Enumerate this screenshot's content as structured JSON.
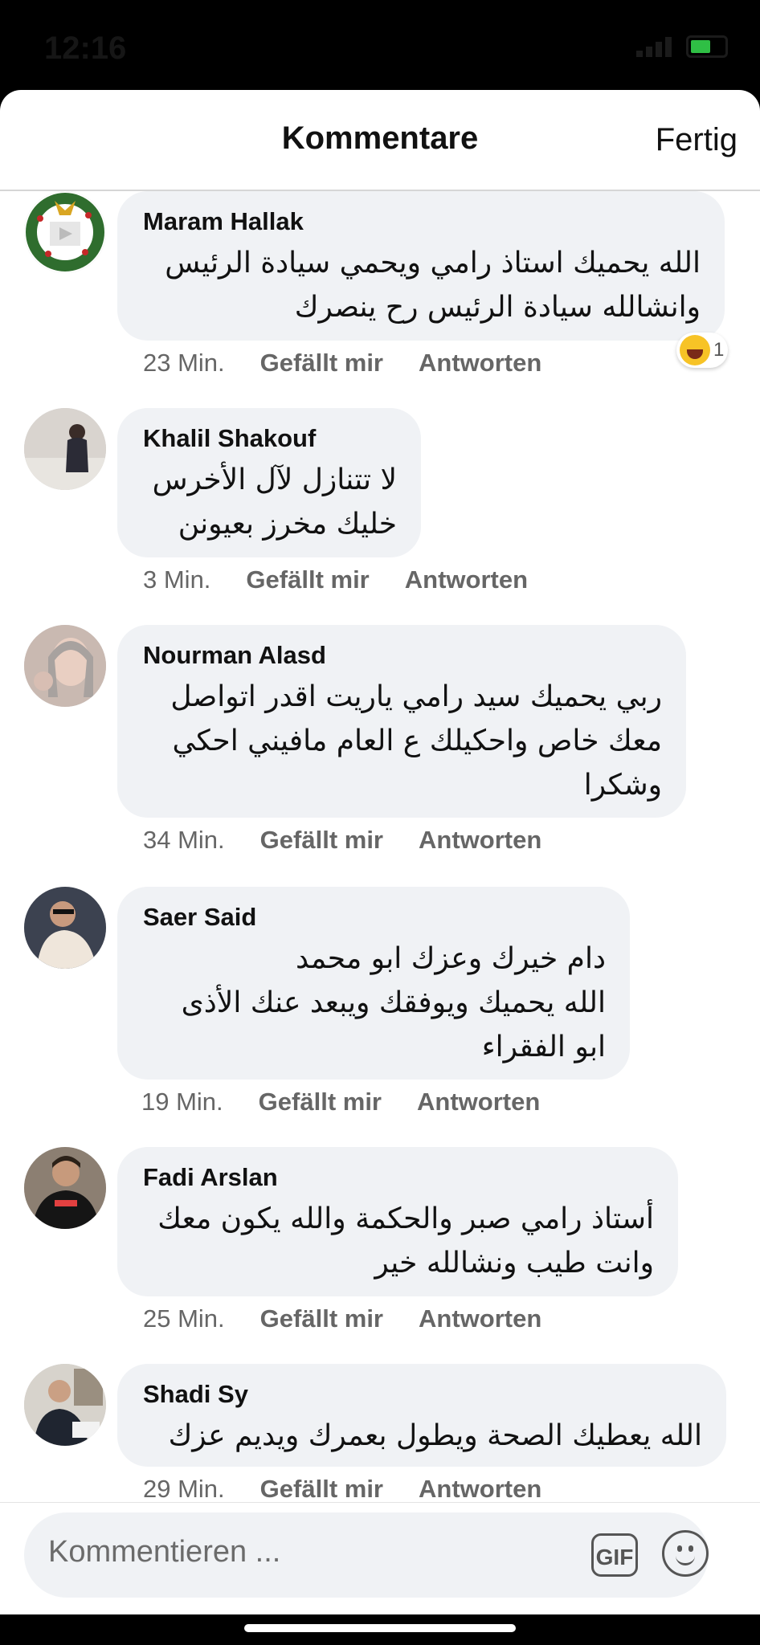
{
  "status_bar": {
    "time": "12:16"
  },
  "header": {
    "title": "Kommentare",
    "done_label": "Fertig"
  },
  "actions": {
    "like": "Gefällt mir",
    "reply": "Antworten"
  },
  "comments": [
    {
      "author": "Maram Hallak",
      "lines": [
        "الله يحميك استاذ رامي ويحمي سيادة الرئيس",
        "وانشالله سيادة الرئيس رح ينصرك"
      ],
      "time": "23 Min.",
      "reaction_count": "1"
    },
    {
      "author": "Khalil Shakouf",
      "lines": [
        "لا تتنازل لآل الأخرس",
        "خليك مخرز بعيونن"
      ],
      "time": "3 Min."
    },
    {
      "author": "Nourman Alasd",
      "lines": [
        "ربي يحميك سيد رامي ياريت اقدر اتواصل",
        "معك خاص واحكيلك ع العام مافيني احكي",
        "وشكرا"
      ],
      "time": "34 Min."
    },
    {
      "author": "Saer Said",
      "lines": [
        "دام خيرك وعزك ابو محمد",
        "الله يحميك ويوفقك ويبعد عنك الأذى",
        "ابو الفقراء"
      ],
      "time": "19 Min."
    },
    {
      "author": "Fadi Arslan",
      "lines": [
        "أستاذ رامي صبر والحكمة والله يكون معك",
        "وانت طيب ونشالله خير"
      ],
      "time": "25 Min."
    },
    {
      "author": "Shadi Sy",
      "lines": [
        "الله يعطيك الصحة ويطول بعمرك ويديم عزك"
      ],
      "time": "29 Min."
    }
  ],
  "composer": {
    "placeholder": "Kommentieren ...",
    "gif_label": "GIF"
  }
}
